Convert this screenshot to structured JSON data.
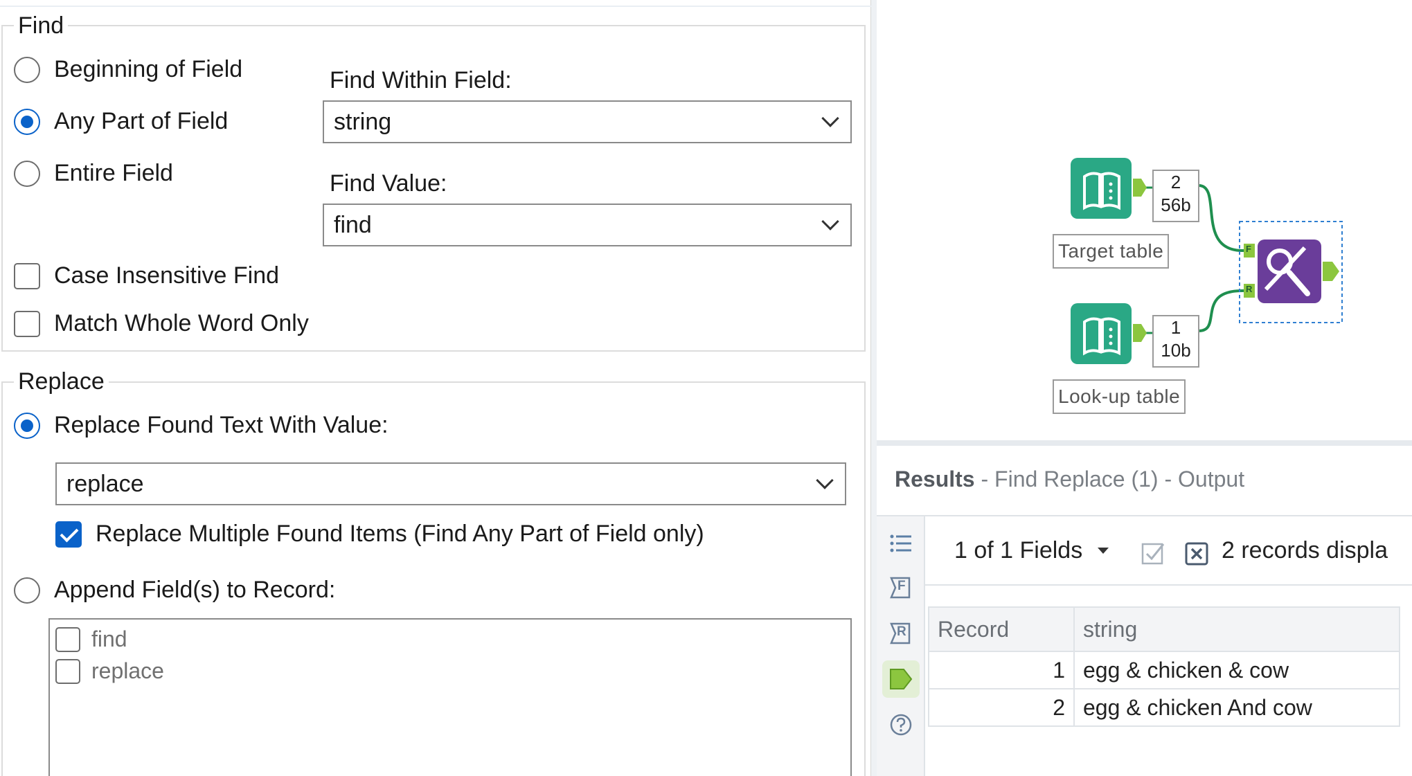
{
  "find": {
    "group_title": "Find",
    "options": [
      "Beginning of Field",
      "Any Part of Field",
      "Entire Field"
    ],
    "selected_option": 1,
    "within_label": "Find Within Field:",
    "within_value": "string",
    "find_value_label": "Find Value:",
    "find_value": "find",
    "case_insensitive_label": "Case Insensitive Find",
    "case_insensitive_checked": false,
    "whole_word_label": "Match Whole Word Only",
    "whole_word_checked": false
  },
  "replace": {
    "group_title": "Replace",
    "replace_found_label": "Replace Found Text With Value:",
    "replace_found_selected": true,
    "replace_value": "replace",
    "multiple_label": "Replace Multiple Found Items (Find Any Part of Field only)",
    "multiple_checked": true,
    "append_label": "Append Field(s) to Record:",
    "append_selected": false,
    "append_fields": [
      {
        "label": "find",
        "checked": false
      },
      {
        "label": "replace",
        "checked": false
      }
    ]
  },
  "workflow": {
    "target_label": "Target table",
    "target_count": "2",
    "target_size": "56b",
    "lookup_label": "Look-up table",
    "lookup_count": "1",
    "lookup_size": "10b",
    "anchor_f": "F",
    "anchor_r": "R",
    "colors": {
      "input_tool": "#2aa885",
      "find_replace_tool": "#6a3d9a",
      "connector": "#1f8f4f",
      "anchor": "#8cc63f",
      "selection": "#2f7fd1"
    }
  },
  "results": {
    "title": "Results",
    "subtitle": "- Find Replace (1) - Output",
    "fields_selector": "1 of 1 Fields",
    "records_text": "2 records displa",
    "side_tool_labels": {
      "f": "F",
      "r": "R"
    },
    "columns": [
      "Record",
      "string"
    ],
    "rows": [
      {
        "record": "1",
        "string": "egg & chicken & cow"
      },
      {
        "record": "2",
        "string": "egg & chicken And cow"
      }
    ]
  },
  "icons": [
    "chevron-down-icon",
    "list-icon",
    "f-anchor-icon",
    "r-anchor-icon",
    "output-anchor-icon",
    "help-icon",
    "check-all-icon",
    "uncheck-all-icon",
    "book-icon",
    "magnifier-percent-icon"
  ]
}
